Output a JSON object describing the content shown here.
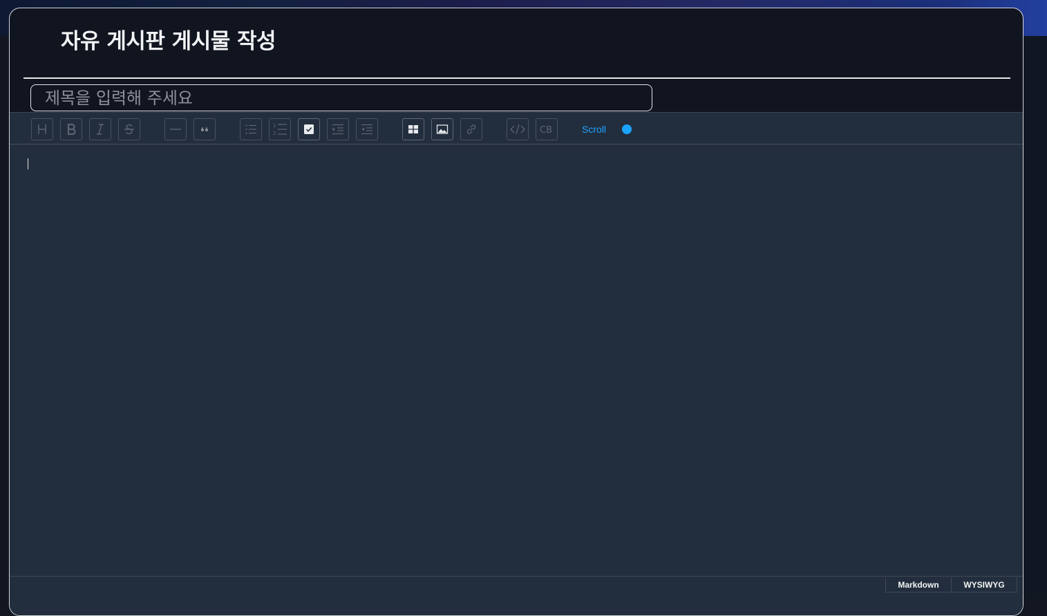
{
  "page": {
    "title": "자유 게시판 게시물 작성"
  },
  "title_input": {
    "placeholder": "제목을 입력해 주세요",
    "value": ""
  },
  "toolbar": {
    "buttons": [
      {
        "name": "heading",
        "icon": "heading-icon",
        "glyph": "H"
      },
      {
        "name": "bold",
        "icon": "bold-icon",
        "glyph": "B"
      },
      {
        "name": "italic",
        "icon": "italic-icon",
        "glyph": "I"
      },
      {
        "name": "strike",
        "icon": "strike-icon",
        "glyph": "S"
      },
      {
        "name": "horizontal-line",
        "icon": "hr-icon"
      },
      {
        "name": "quote",
        "icon": "quote-icon"
      },
      {
        "name": "bullet-list",
        "icon": "bullet-list-icon"
      },
      {
        "name": "ordered-list",
        "icon": "ordered-list-icon"
      },
      {
        "name": "task-list",
        "icon": "checkbox-icon"
      },
      {
        "name": "indent",
        "icon": "indent-icon"
      },
      {
        "name": "outdent",
        "icon": "outdent-icon"
      },
      {
        "name": "table",
        "icon": "table-icon"
      },
      {
        "name": "image",
        "icon": "image-icon"
      },
      {
        "name": "link",
        "icon": "link-icon"
      },
      {
        "name": "code",
        "icon": "code-icon"
      },
      {
        "name": "code-block",
        "icon": "code-block-icon",
        "glyph": "CB"
      }
    ],
    "scroll_sync_label": "Scroll",
    "scroll_sync_on": true,
    "accent_color": "#1aa3ff"
  },
  "mode_switch": {
    "markdown_label": "Markdown",
    "wysiwyg_label": "WYSIWYG"
  }
}
